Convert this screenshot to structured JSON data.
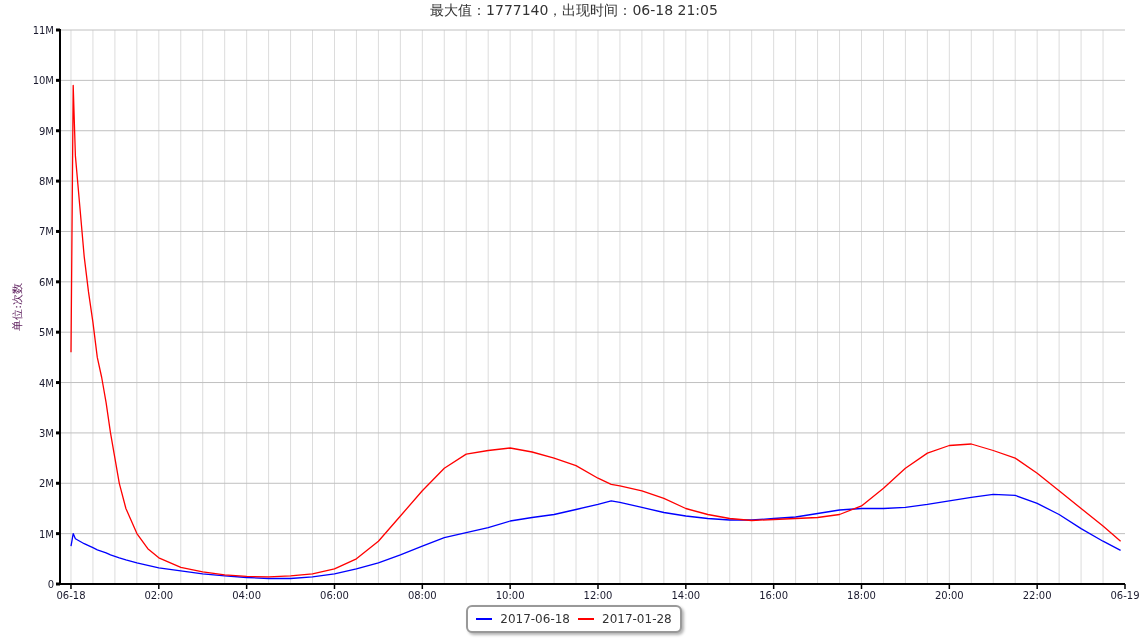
{
  "title": "最大值：1777140，出现时间：06-18 21:05",
  "chart_data": {
    "type": "line",
    "grid": true,
    "ylabel": "单位:次数",
    "xlim": [
      -0.25,
      24
    ],
    "ylim": [
      0,
      11
    ],
    "xticks": [
      {
        "value": 0,
        "label": "06-18"
      },
      {
        "value": 2,
        "label": "02:00"
      },
      {
        "value": 4,
        "label": "04:00"
      },
      {
        "value": 6,
        "label": "06:00"
      },
      {
        "value": 8,
        "label": "08:00"
      },
      {
        "value": 10,
        "label": "10:00"
      },
      {
        "value": 12,
        "label": "12:00"
      },
      {
        "value": 14,
        "label": "14:00"
      },
      {
        "value": 16,
        "label": "16:00"
      },
      {
        "value": 18,
        "label": "18:00"
      },
      {
        "value": 20,
        "label": "20:00"
      },
      {
        "value": 22,
        "label": "22:00"
      },
      {
        "value": 24,
        "label": "06-19"
      }
    ],
    "yticks": [
      {
        "value": 0,
        "label": "0"
      },
      {
        "value": 1,
        "label": "1M"
      },
      {
        "value": 2,
        "label": "2M"
      },
      {
        "value": 3,
        "label": "3M"
      },
      {
        "value": 4,
        "label": "4M"
      },
      {
        "value": 5,
        "label": "5M"
      },
      {
        "value": 6,
        "label": "6M"
      },
      {
        "value": 7,
        "label": "7M"
      },
      {
        "value": 8,
        "label": "8M"
      },
      {
        "value": 9,
        "label": "9M"
      },
      {
        "value": 10,
        "label": "10M"
      },
      {
        "value": 11,
        "label": "11M"
      }
    ],
    "x": [
      0,
      0.05,
      0.1,
      0.2,
      0.3,
      0.4,
      0.5,
      0.6,
      0.7,
      0.8,
      0.9,
      1,
      1.1,
      1.25,
      1.5,
      1.75,
      2,
      2.5,
      3,
      3.5,
      4,
      4.5,
      5,
      5.5,
      6,
      6.5,
      7,
      7.5,
      8,
      8.5,
      9,
      9.5,
      10,
      10.5,
      11,
      11.5,
      12,
      12.3,
      12.5,
      13,
      13.5,
      14,
      14.5,
      15,
      15.5,
      16,
      16.5,
      17,
      17.5,
      18,
      18.5,
      19,
      19.5,
      20,
      20.5,
      21,
      21.5,
      22,
      22.5,
      23,
      23.5,
      23.9
    ],
    "series": [
      {
        "name": "2017-06-18",
        "color": "#0000ff",
        "values": [
          0.75,
          1.0,
          0.9,
          0.85,
          0.8,
          0.76,
          0.72,
          0.68,
          0.65,
          0.62,
          0.58,
          0.55,
          0.52,
          0.48,
          0.42,
          0.37,
          0.32,
          0.26,
          0.2,
          0.16,
          0.13,
          0.11,
          0.11,
          0.14,
          0.2,
          0.3,
          0.42,
          0.58,
          0.75,
          0.92,
          1.02,
          1.12,
          1.25,
          1.32,
          1.38,
          1.48,
          1.58,
          1.65,
          1.62,
          1.52,
          1.42,
          1.35,
          1.3,
          1.27,
          1.27,
          1.3,
          1.33,
          1.4,
          1.47,
          1.5,
          1.5,
          1.52,
          1.58,
          1.65,
          1.72,
          1.78,
          1.76,
          1.6,
          1.38,
          1.1,
          0.85,
          0.67
        ]
      },
      {
        "name": "2017-01-28",
        "color": "#ff0000",
        "values": [
          4.6,
          9.9,
          8.5,
          7.5,
          6.5,
          5.8,
          5.2,
          4.5,
          4.1,
          3.6,
          3.0,
          2.5,
          2.0,
          1.5,
          1.0,
          0.7,
          0.52,
          0.33,
          0.24,
          0.18,
          0.15,
          0.14,
          0.16,
          0.2,
          0.3,
          0.5,
          0.85,
          1.35,
          1.85,
          2.3,
          2.58,
          2.65,
          2.7,
          2.62,
          2.5,
          2.35,
          2.1,
          1.98,
          1.95,
          1.85,
          1.7,
          1.5,
          1.38,
          1.3,
          1.26,
          1.28,
          1.3,
          1.32,
          1.38,
          1.55,
          1.9,
          2.3,
          2.6,
          2.75,
          2.78,
          2.65,
          2.5,
          2.2,
          1.85,
          1.5,
          1.15,
          0.85
        ]
      }
    ]
  }
}
